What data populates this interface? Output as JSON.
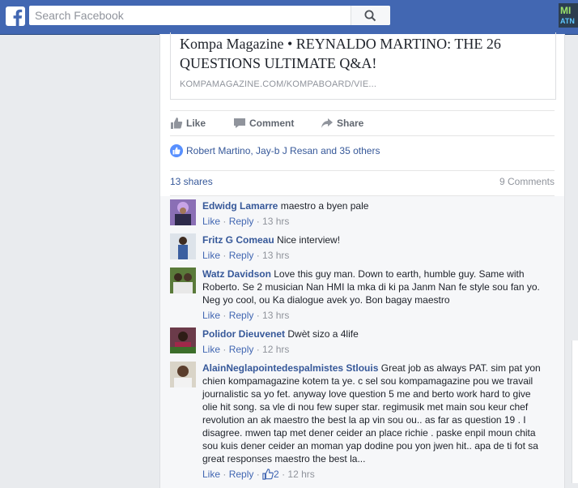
{
  "topbar": {
    "search_placeholder": "Search Facebook",
    "corner_badge_line1": "MI",
    "corner_badge_line2": "ATN"
  },
  "post": {
    "link_title": "Kompa Magazine • REYNALDO MARTINO: THE 26 QUESTIONS ULTIMATE Q&A!",
    "link_domain": "KOMPAMAGAZINE.COM/KOMPABOARD/VIE...",
    "actions": {
      "like": "Like",
      "comment": "Comment",
      "share": "Share"
    },
    "likes_text": "Robert Martino, Jay-b J Resan and 35 others",
    "shares_text": "13 shares",
    "comments_count_text": "9 Comments"
  },
  "comments": [
    {
      "author": "Edwidg Lamarre",
      "text": "maestro a byen pale",
      "like": "Like",
      "reply": "Reply",
      "time": "13 hrs"
    },
    {
      "author": "Fritz G Comeau",
      "text": "Nice interview!",
      "like": "Like",
      "reply": "Reply",
      "time": "13 hrs"
    },
    {
      "author": "Watz Davidson",
      "text": "Love this guy man. Down to earth, humble guy. Same with Roberto. Se 2 musician Nan HMI la mka di ki pa Janm Nan fe style sou fan yo. Neg yo cool, ou Ka dialogue avek yo. Bon bagay maestro",
      "like": "Like",
      "reply": "Reply",
      "time": "13 hrs"
    },
    {
      "author": "Polidor Dieuvenet",
      "text": "Dwèt sizo a 4life",
      "like": "Like",
      "reply": "Reply",
      "time": "12 hrs"
    },
    {
      "author": "AlainNeglapointedespalmistes Stlouis",
      "text": "Great job as always PAT. sim pat yon chien kompamagazine kotem ta ye. c sel sou kompamagazine pou we travail journalistic sa yo fet. anyway love question 5 me and berto work hard to give olie hit song. sa vle di nou few super star. regimusik met main sou keur chef revolution an ak maestro the best la ap vin sou ou.. as far as question 19 . I disagree. mwen tap met dener ceider an place richie . paske enpil moun chita sou kuis dener ceider an moman yap dodine pou yon jwen hit.. apa de ti fot sa great responses maestro the best la...",
      "like": "Like",
      "reply": "Reply",
      "reaction_count": "2",
      "time": "12 hrs"
    }
  ],
  "colors": {
    "brand": "#4267b2",
    "link": "#365899",
    "meta": "#90949c"
  }
}
